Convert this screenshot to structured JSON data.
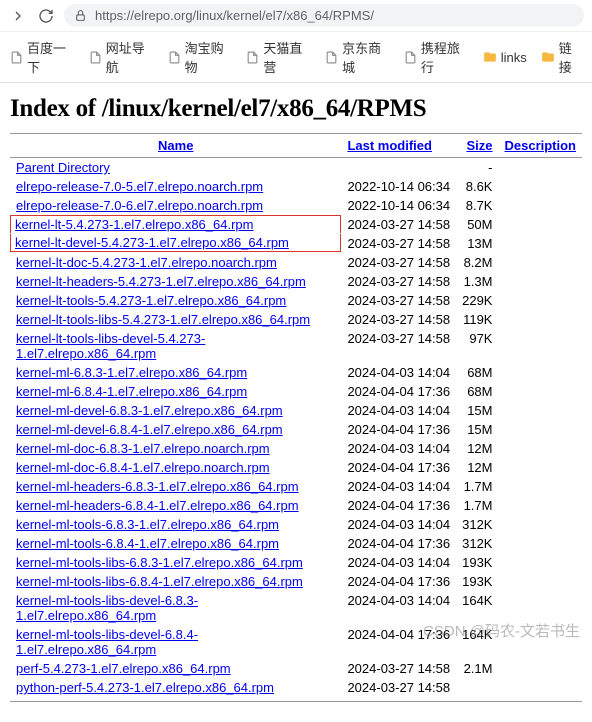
{
  "browser": {
    "url": "https://elrepo.org/linux/kernel/el7/x86_64/RPMS/"
  },
  "bookmarks": [
    {
      "label": "百度一下",
      "icon": "page"
    },
    {
      "label": "网址导航",
      "icon": "page"
    },
    {
      "label": "淘宝购物",
      "icon": "page"
    },
    {
      "label": "天猫直营",
      "icon": "page"
    },
    {
      "label": "京东商城",
      "icon": "page"
    },
    {
      "label": "携程旅行",
      "icon": "page"
    },
    {
      "label": "links",
      "icon": "folder"
    },
    {
      "label": "链接",
      "icon": "folder"
    }
  ],
  "page": {
    "title": "Index of /linux/kernel/el7/x86_64/RPMS"
  },
  "headers": {
    "name": "Name",
    "modified": "Last modified",
    "size": "Size",
    "desc": "Description"
  },
  "parent": {
    "name": "Parent Directory",
    "size": "-"
  },
  "highlighted": [
    {
      "name": "kernel-lt-5.4.273-1.el7.elrepo.x86_64.rpm",
      "modified": "2024-03-27 14:58",
      "size": "50M"
    },
    {
      "name": "kernel-lt-devel-5.4.273-1.el7.elrepo.x86_64.rpm",
      "modified": "2024-03-27 14:58",
      "size": "13M"
    }
  ],
  "rows_before": [
    {
      "name": "elrepo-release-7.0-5.el7.elrepo.noarch.rpm",
      "modified": "2022-10-14 06:34",
      "size": "8.6K"
    },
    {
      "name": "elrepo-release-7.0-6.el7.elrepo.noarch.rpm",
      "modified": "2022-10-14 06:34",
      "size": "8.7K"
    }
  ],
  "rows_after": [
    {
      "name": "kernel-lt-doc-5.4.273-1.el7.elrepo.noarch.rpm",
      "modified": "2024-03-27 14:58",
      "size": "8.2M"
    },
    {
      "name": "kernel-lt-headers-5.4.273-1.el7.elrepo.x86_64.rpm",
      "modified": "2024-03-27 14:58",
      "size": "1.3M"
    },
    {
      "name": "kernel-lt-tools-5.4.273-1.el7.elrepo.x86_64.rpm",
      "modified": "2024-03-27 14:58",
      "size": "229K"
    },
    {
      "name": "kernel-lt-tools-libs-5.4.273-1.el7.elrepo.x86_64.rpm",
      "modified": "2024-03-27 14:58",
      "size": "119K"
    },
    {
      "name": "kernel-lt-tools-libs-devel-5.4.273-1.el7.elrepo.x86_64.rpm",
      "modified": "2024-03-27 14:58",
      "size": "97K"
    },
    {
      "name": "kernel-ml-6.8.3-1.el7.elrepo.x86_64.rpm",
      "modified": "2024-04-03 14:04",
      "size": "68M"
    },
    {
      "name": "kernel-ml-6.8.4-1.el7.elrepo.x86_64.rpm",
      "modified": "2024-04-04 17:36",
      "size": "68M"
    },
    {
      "name": "kernel-ml-devel-6.8.3-1.el7.elrepo.x86_64.rpm",
      "modified": "2024-04-03 14:04",
      "size": "15M"
    },
    {
      "name": "kernel-ml-devel-6.8.4-1.el7.elrepo.x86_64.rpm",
      "modified": "2024-04-04 17:36",
      "size": "15M"
    },
    {
      "name": "kernel-ml-doc-6.8.3-1.el7.elrepo.noarch.rpm",
      "modified": "2024-04-03 14:04",
      "size": "12M"
    },
    {
      "name": "kernel-ml-doc-6.8.4-1.el7.elrepo.noarch.rpm",
      "modified": "2024-04-04 17:36",
      "size": "12M"
    },
    {
      "name": "kernel-ml-headers-6.8.3-1.el7.elrepo.x86_64.rpm",
      "modified": "2024-04-03 14:04",
      "size": "1.7M"
    },
    {
      "name": "kernel-ml-headers-6.8.4-1.el7.elrepo.x86_64.rpm",
      "modified": "2024-04-04 17:36",
      "size": "1.7M"
    },
    {
      "name": "kernel-ml-tools-6.8.3-1.el7.elrepo.x86_64.rpm",
      "modified": "2024-04-03 14:04",
      "size": "312K"
    },
    {
      "name": "kernel-ml-tools-6.8.4-1.el7.elrepo.x86_64.rpm",
      "modified": "2024-04-04 17:36",
      "size": "312K"
    },
    {
      "name": "kernel-ml-tools-libs-6.8.3-1.el7.elrepo.x86_64.rpm",
      "modified": "2024-04-03 14:04",
      "size": "193K"
    },
    {
      "name": "kernel-ml-tools-libs-6.8.4-1.el7.elrepo.x86_64.rpm",
      "modified": "2024-04-04 17:36",
      "size": "193K"
    },
    {
      "name": "kernel-ml-tools-libs-devel-6.8.3-1.el7.elrepo.x86_64.rpm",
      "modified": "2024-04-03 14:04",
      "size": "164K"
    },
    {
      "name": "kernel-ml-tools-libs-devel-6.8.4-1.el7.elrepo.x86_64.rpm",
      "modified": "2024-04-04 17:36",
      "size": "164K"
    },
    {
      "name": "perf-5.4.273-1.el7.elrepo.x86_64.rpm",
      "modified": "2024-03-27 14:58",
      "size": "2.1M"
    },
    {
      "name": "python-perf-5.4.273-1.el7.elrepo.x86_64.rpm",
      "modified": "2024-03-27 14:58",
      "size": ""
    }
  ],
  "watermark": "CSDN @码农-文若书生"
}
